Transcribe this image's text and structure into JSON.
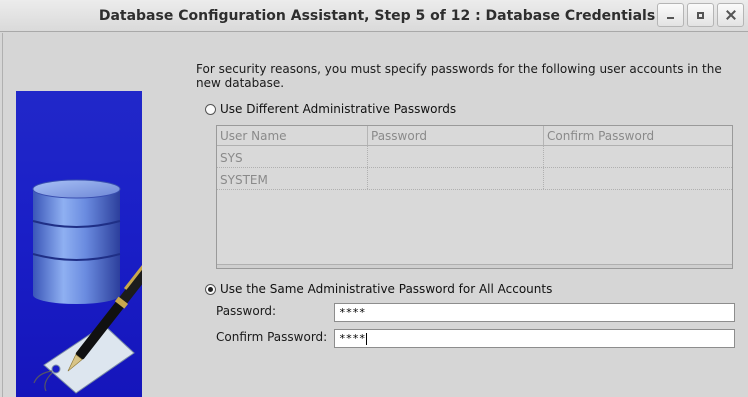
{
  "window": {
    "title": "Database Configuration Assistant, Step 5 of 12 : Database Credentials"
  },
  "intro_text": "For security reasons, you must specify passwords for the following user accounts in the new database.",
  "options": {
    "different": {
      "label": "Use Different Administrative Passwords",
      "selected": false
    },
    "same": {
      "label": "Use the Same Administrative Password for All Accounts",
      "selected": true
    }
  },
  "table": {
    "headers": [
      "User Name",
      "Password",
      "Confirm Password"
    ],
    "rows": [
      {
        "user": "SYS",
        "password": "",
        "confirm": ""
      },
      {
        "user": "SYSTEM",
        "password": "",
        "confirm": ""
      }
    ]
  },
  "password_field": {
    "label": "Password:",
    "value": "****"
  },
  "confirm_field": {
    "label": "Confirm Password:",
    "value": "****"
  },
  "colors": {
    "illustration_bg": "#1a1fc7"
  },
  "icons": [
    "minimize-icon",
    "maximize-icon",
    "close-icon",
    "database-cylinder-icon",
    "fountain-pen-icon",
    "tag-icon"
  ]
}
